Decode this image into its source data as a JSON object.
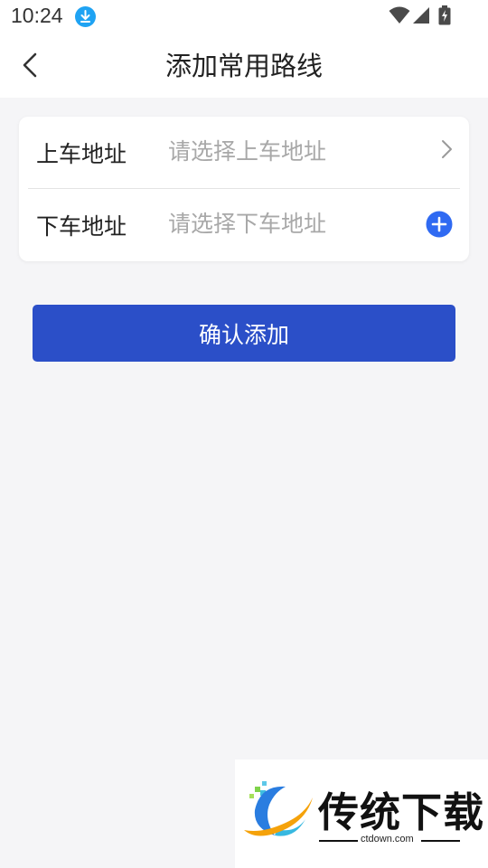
{
  "status_bar": {
    "time": "10:24",
    "download_icon": "download-icon",
    "wifi_icon": "wifi-icon",
    "signal_icon": "signal-icon",
    "battery_icon": "battery-icon"
  },
  "nav": {
    "back_icon": "chevron-left-icon",
    "title": "添加常用路线"
  },
  "form": {
    "pickup": {
      "label": "上车地址",
      "placeholder": "请选择上车地址",
      "value": "",
      "icon": "chevron-right-icon"
    },
    "dropoff": {
      "label": "下车地址",
      "placeholder": "请选择下车地址",
      "value": "",
      "icon": "add-circle-icon"
    }
  },
  "confirm_label": "确认添加",
  "watermark": {
    "brand": "传统下载",
    "domain": "ctdown.com"
  },
  "colors": {
    "accent": "#2b4fc8",
    "add_icon": "#2f6af2",
    "download_badge": "#1fa3f3",
    "background": "#f5f5f7",
    "placeholder": "#a8a8a8"
  }
}
